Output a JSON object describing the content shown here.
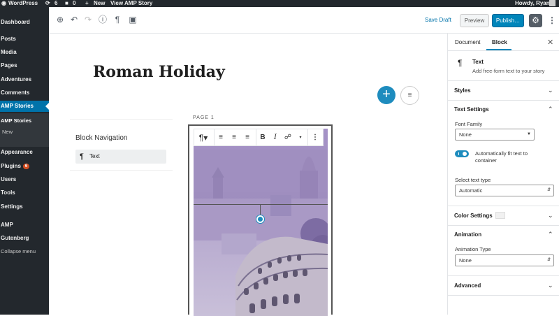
{
  "admin_bar": {
    "site_name": "WordPress",
    "updates_count": "6",
    "comments_count": "0",
    "new_label": "New",
    "view_link": "View AMP Story",
    "greeting": "Howdy, Ryan"
  },
  "admin_menu": {
    "dashboard": "Dashboard",
    "posts": "Posts",
    "media": "Media",
    "pages": "Pages",
    "adventures": "Adventures",
    "comments": "Comments",
    "amp_stories": "AMP Stories",
    "sub_amp_stories": "AMP Stories",
    "sub_new": "New",
    "appearance": "Appearance",
    "plugins": "Plugins",
    "plugins_badge": "6",
    "users": "Users",
    "tools": "Tools",
    "settings": "Settings",
    "amp": "AMP",
    "gutenberg": "Gutenberg",
    "collapse": "Collapse menu"
  },
  "header": {
    "save_draft": "Save Draft",
    "preview": "Preview",
    "publish": "Publish…"
  },
  "canvas": {
    "title": "Roman Holiday",
    "block_navigation_title": "Block Navigation",
    "block_navigation_item": "Text",
    "page_label": "PAGE 1"
  },
  "sidebar": {
    "tab_document": "Document",
    "tab_block": "Block",
    "block_name": "Text",
    "block_description": "Add free-form text to your story",
    "styles": "Styles",
    "text_settings": "Text Settings",
    "font_family_label": "Font Family",
    "font_family_value": "None",
    "autofit_label": "Automatically fit text to container",
    "text_type_label": "Select text type",
    "text_type_value": "Automatic",
    "color_settings": "Color Settings",
    "animation": "Animation",
    "animation_type_label": "Animation Type",
    "animation_type_value": "None",
    "advanced": "Advanced"
  },
  "colors": {
    "admin_dark": "#23282d",
    "accent_blue": "#0073aa",
    "publish_blue": "#0085ba",
    "story_purple": "#a592c7"
  }
}
